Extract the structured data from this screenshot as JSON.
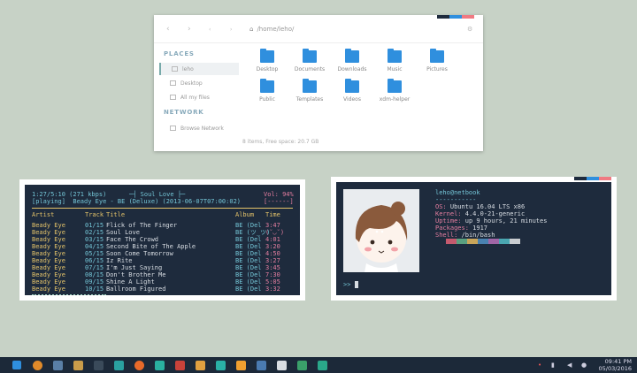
{
  "file_manager": {
    "path": "/home/leho/",
    "sections": {
      "places": "PLACES",
      "network": "NETWORK"
    },
    "places": [
      "leho",
      "Desktop",
      "All my files"
    ],
    "network": [
      "Browse Network"
    ],
    "folders": [
      "Desktop",
      "Documents",
      "Downloads",
      "Music",
      "Pictures",
      "Public",
      "Templates",
      "Videos",
      "xdm-helper"
    ],
    "status": "8 items, Free space: 20.7 GB"
  },
  "cmus": {
    "header_left": "1:27/5:10 (271 kbps)",
    "header_title": "─┤ Soul Love ├─",
    "vol": "Vol: 94%",
    "playing": "[playing]  Beady Eye - BE (Deluxe) (2013-06-07T07:00:02)",
    "vol_bar": "[------]",
    "columns": {
      "artist": "Artist",
      "track": "Track",
      "title": "Title",
      "album": "Album",
      "time": "Time"
    },
    "rows": [
      {
        "artist": "Beady Eye",
        "track": "01/15",
        "title": "Flick of The Finger",
        "album": "BE (Del",
        "time": "3:47"
      },
      {
        "artist": "Beady Eye",
        "track": "02/15",
        "title": "Soul Love",
        "album": "BE (ツ_ツ)",
        "time": "(˘◡˘)"
      },
      {
        "artist": "Beady Eye",
        "track": "03/15",
        "title": "Face The Crowd",
        "album": "BE (Del",
        "time": "4:01"
      },
      {
        "artist": "Beady Eye",
        "track": "04/15",
        "title": "Second Bite of The Apple",
        "album": "BE (Del",
        "time": "3:20"
      },
      {
        "artist": "Beady Eye",
        "track": "05/15",
        "title": "Soon Come Tomorrow",
        "album": "BE (Del",
        "time": "4:50"
      },
      {
        "artist": "Beady Eye",
        "track": "06/15",
        "title": "Iz Rite",
        "album": "BE (Del",
        "time": "3:27"
      },
      {
        "artist": "Beady Eye",
        "track": "07/15",
        "title": "I'm Just Saying",
        "album": "BE (Del",
        "time": "3:45"
      },
      {
        "artist": "Beady Eye",
        "track": "08/15",
        "title": "Don't Brother Me",
        "album": "BE (Del",
        "time": "7:30"
      },
      {
        "artist": "Beady Eye",
        "track": "09/15",
        "title": "Shine A Light",
        "album": "BE (Del",
        "time": "5:05"
      },
      {
        "artist": "Beady Eye",
        "track": "10/15",
        "title": "Ballroom Figured",
        "album": "BE (Del",
        "time": "3:32"
      }
    ],
    "progress": 0.28
  },
  "neofetch": {
    "user": "leho@netbook",
    "underline": "-----------",
    "os_label": "OS:",
    "os": "Ubuntu 16.04 LTS x86",
    "kernel_label": "Kernel:",
    "kernel": "4.4.0-21-generic",
    "uptime_label": "Uptime:",
    "uptime": "up 9 hours, 21 minutes",
    "packages_label": "Packages:",
    "packages": "1917",
    "shell_label": "Shell:",
    "shell": "/bin/bash",
    "prompt": ">>"
  },
  "palette": [
    "#1e2b3d",
    "#c45a6e",
    "#5aa080",
    "#c9a55a",
    "#4a82b0",
    "#a066a6",
    "#4aa6b0",
    "#c8ccd0"
  ],
  "stripes": [
    "#1e2b3d",
    "#2f8fde",
    "#f07a82"
  ],
  "taskbar": {
    "time": "09:41 PM",
    "date": "05/03/2016",
    "apps": [
      "windows-icon",
      "firefox-icon",
      "rocket-icon",
      "files-icon",
      "terminal-icon",
      "photo-icon",
      "orange-icon",
      "umbrella-icon",
      "ghost-icon",
      "burger-icon",
      "cloud-icon",
      "vlc-icon",
      "calc-icon",
      "send-icon",
      "tree-icon",
      "box-icon"
    ]
  }
}
